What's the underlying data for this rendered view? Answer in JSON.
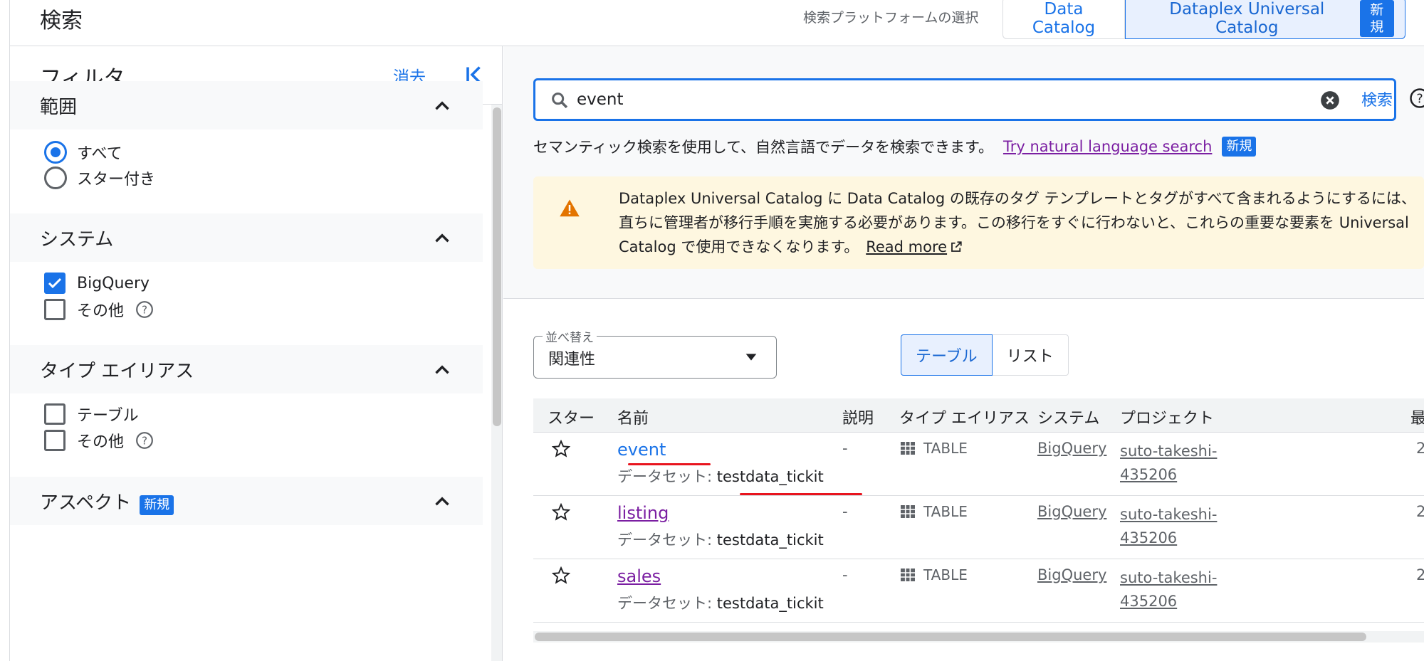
{
  "header": {
    "page_title": "検索",
    "platform_label": "検索プラットフォームの選択",
    "platforms": [
      {
        "label": "Data Catalog",
        "selected": false
      },
      {
        "label": "Dataplex Universal Catalog",
        "selected": true,
        "badge": "新規"
      }
    ]
  },
  "filter": {
    "title": "フィルタ",
    "clear_label": "消去",
    "sections": [
      {
        "label": "範囲",
        "expanded": true,
        "options": [
          {
            "label": "すべて",
            "type": "radio",
            "checked": true
          },
          {
            "label": "スター付き",
            "type": "radio",
            "checked": false
          }
        ]
      },
      {
        "label": "システム",
        "expanded": true,
        "options": [
          {
            "label": "BigQuery",
            "type": "checkbox",
            "checked": true
          },
          {
            "label": "その他",
            "type": "checkbox",
            "checked": false,
            "help": true
          }
        ]
      },
      {
        "label": "タイプ エイリアス",
        "expanded": true,
        "options": [
          {
            "label": "テーブル",
            "type": "checkbox",
            "checked": false
          },
          {
            "label": "その他",
            "type": "checkbox",
            "checked": false,
            "help": true
          }
        ]
      },
      {
        "label": "アスペクト",
        "badge": "新規",
        "expanded": true
      }
    ]
  },
  "search": {
    "query": "event",
    "button_label": "検索",
    "semantic_text": "セマンティック検索を使用して、自然言語でデータを検索できます。",
    "semantic_link": "Try natural language search",
    "semantic_badge": "新規"
  },
  "warning": {
    "text": "Dataplex Universal Catalog に Data Catalog の既存のタグ テンプレートとタグがすべて含まれるようにするには、直ちに管理者が移行手順を実施する必要があります。この移行をすぐに行わないと、これらの重要な要素を Universal Catalog で使用できなくなります。",
    "link": "Read more"
  },
  "sort": {
    "label": "並べ替え",
    "value": "関連性"
  },
  "view_toggle": [
    {
      "label": "テーブル",
      "selected": true
    },
    {
      "label": "リスト",
      "selected": false
    }
  ],
  "table": {
    "columns": [
      "スター",
      "名前",
      "説明",
      "タイプ エイリアス",
      "システム",
      "プロジェクト",
      "最"
    ],
    "dataset_prefix": "データセット: ",
    "rows": [
      {
        "name": "event",
        "dataset": "testdata_tickit",
        "description": "-",
        "type": "TABLE",
        "system": "BigQuery",
        "project_line1": "suto-takeshi-",
        "project_line2": "435206",
        "trunc": "2"
      },
      {
        "name": "listing",
        "dataset": "testdata_tickit",
        "description": "-",
        "type": "TABLE",
        "system": "BigQuery",
        "project_line1": "suto-takeshi-",
        "project_line2": "435206",
        "trunc": "2"
      },
      {
        "name": "sales",
        "dataset": "testdata_tickit",
        "description": "-",
        "type": "TABLE",
        "system": "BigQuery",
        "project_line1": "suto-takeshi-",
        "project_line2": "435206",
        "trunc": "2"
      }
    ]
  },
  "colors": {
    "accent": "#1a73e8",
    "visited_link": "#7b1fa2",
    "warning_bg": "#fef7e0",
    "warning_icon": "#e37400",
    "annotation": "#e8141e"
  }
}
